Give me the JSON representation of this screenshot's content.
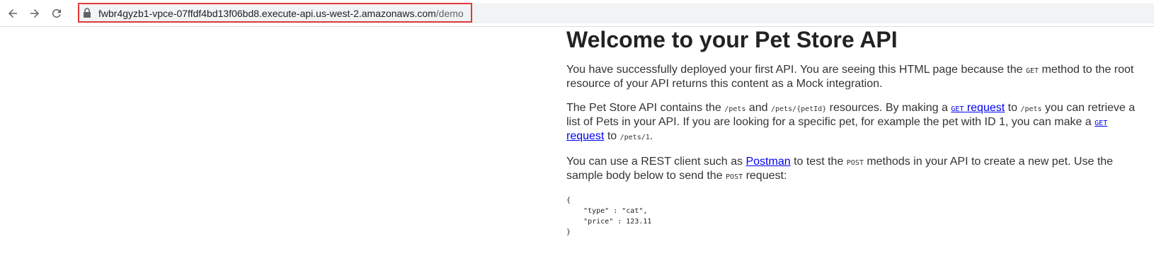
{
  "browser": {
    "url_host": "fwbr4gyzb1-vpce-07ffdf4bd13f06bd8.execute-api.us-west-2.amazonaws.com",
    "url_path": "/demo",
    "highlight_color": "#e03a3a"
  },
  "page": {
    "title": "Welcome to your Pet Store API",
    "p1": {
      "t1": "You have successfully deployed your first API. You are seeing this HTML page because the ",
      "code1": "GET",
      "t2": " method to the root resource of your API returns this content as a Mock integration."
    },
    "p2": {
      "t1": "The Pet Store API contains the ",
      "code1": "/pets",
      "t2": " and ",
      "code2": "/pets/{petId}",
      "t3": " resources. By making a ",
      "link1_code": "GET",
      "link1_text": " request",
      "t4": " to ",
      "code3": "/pets",
      "t5": " you can retrieve a list of Pets in your API. If you are looking for a specific pet, for example the pet with ID 1, you can make a ",
      "link2_code": "GET",
      "link2_text": " request",
      "t6": " to ",
      "code4": "/pets/1",
      "t7": "."
    },
    "p3": {
      "t1": "You can use a REST client such as ",
      "link": "Postman",
      "t2": " to test the ",
      "code1": "POST",
      "t3": " methods in your API to create a new pet. Use the sample body below to send the ",
      "code2": "POST",
      "t4": " request:"
    },
    "sample_body": "{\n    \"type\" : \"cat\",\n    \"price\" : 123.11\n}"
  }
}
